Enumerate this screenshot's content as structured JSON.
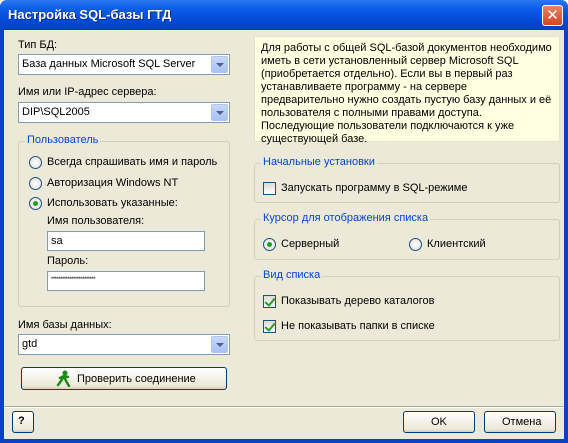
{
  "window": {
    "title": "Настройка SQL-базы ГТД",
    "close_symbol": "✕"
  },
  "db_type": {
    "label": "Тип БД:",
    "value": "База данных Microsoft SQL Server"
  },
  "server": {
    "label": "Имя или IP-адрес сервера:",
    "value": "DIP\\SQL2005"
  },
  "user_group": {
    "title": "Пользователь",
    "options": [
      {
        "label": "Всегда спрашивать имя и пароль",
        "selected": false
      },
      {
        "label": "Авторизация Windows NT",
        "selected": false
      },
      {
        "label": "Использовать указанные:",
        "selected": true
      }
    ],
    "username_label": "Имя пользователя:",
    "username_value": "sa",
    "password_label": "Пароль:",
    "password_value": "************************"
  },
  "database": {
    "label": "Имя базы данных:",
    "value": "gtd"
  },
  "check_connection_button": "Проверить соединение",
  "info_text": "Для работы с общей SQL-базой документов необходимо иметь в сети установленный сервер Microsoft SQL (приобретается отдельно). Если вы в первый раз устанавливаете программу - на сервере предварительно нужно создать пустую базу данных и её пользователя с полными правами доступа. Последующие пользователи подключаются к уже существующей базе.",
  "initial_settings": {
    "title": "Начальные установки",
    "sql_mode_label": "Запускать программу в SQL-режиме",
    "sql_mode_checked": false
  },
  "cursor_group": {
    "title": "Курсор для отображения списка",
    "server_label": "Серверный",
    "client_label": "Клиентский",
    "selected": "server"
  },
  "list_view": {
    "title": "Вид списка",
    "items": [
      {
        "label": "Показывать дерево каталогов",
        "checked": true
      },
      {
        "label": "Не показывать папки в списке",
        "checked": true
      }
    ]
  },
  "help_button": "?",
  "ok_button": "OK",
  "cancel_button": "Отмена"
}
